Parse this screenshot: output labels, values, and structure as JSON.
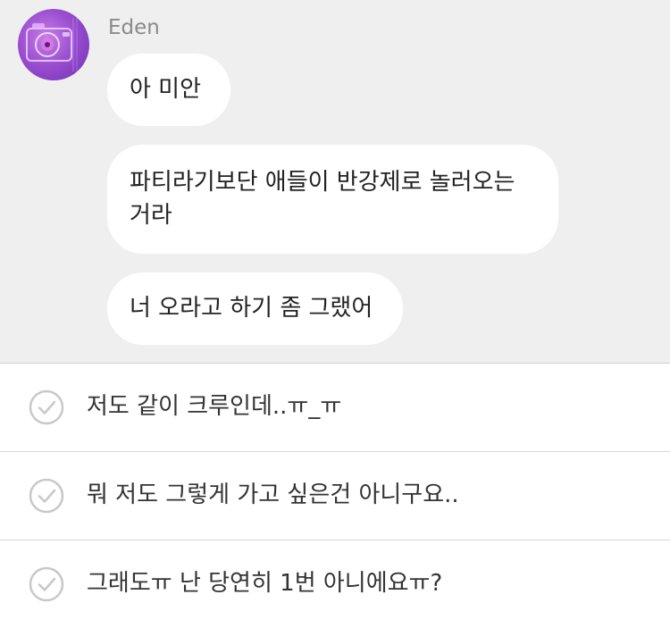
{
  "message": {
    "sender": "Eden",
    "bubbles": [
      "아 미안",
      "파티라기보단 애들이 반강제로 놀러오는 거라",
      "너 오라고 하기 좀 그랬어"
    ]
  },
  "options": [
    "저도 같이 크루인데..ㅠ_ㅠ",
    "뭐 저도 그렇게 가고 싶은건 아니구요..",
    "그래도ㅠ 난 당연히 1번 아니에요ㅠ?"
  ],
  "icons": {
    "avatar": "camera-avatar-icon",
    "option": "check-circle-icon"
  },
  "colors": {
    "chat_background": "#efefef",
    "bubble": "#ffffff",
    "avatar_purple": "#9b4fd1",
    "check_icon": "#c8c8c8"
  }
}
